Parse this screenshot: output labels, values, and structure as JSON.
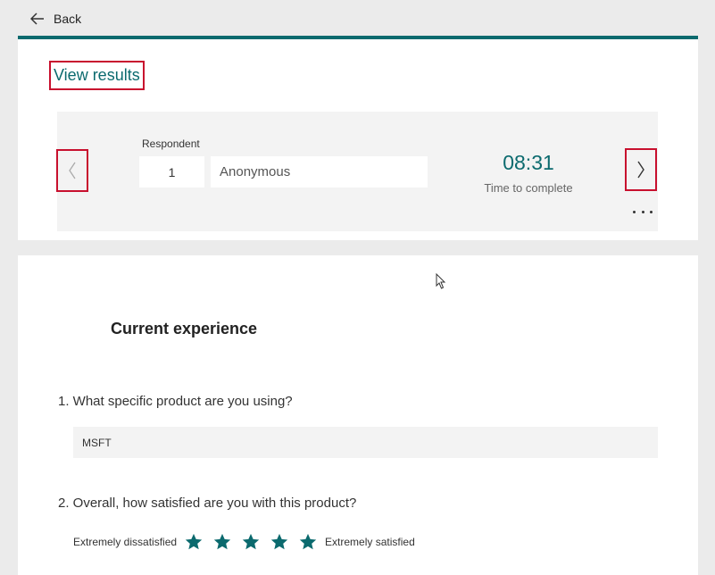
{
  "header": {
    "back_label": "Back"
  },
  "results": {
    "view_results_label": "View results"
  },
  "respondent": {
    "label": "Respondent",
    "number": "1",
    "name": "Anonymous",
    "time": "08:31",
    "time_label": "Time to complete",
    "more_icon": "more-icon"
  },
  "section": {
    "title": "Current experience"
  },
  "questions": [
    {
      "text": "1. What specific product are you using?",
      "answer": "MSFT"
    },
    {
      "text": "2. Overall, how satisfied are you with this product?",
      "min_label": "Extremely dissatisfied",
      "max_label": "Extremely satisfied",
      "rating": 5,
      "max_rating": 5
    }
  ],
  "colors": {
    "accent": "#0b6a6e",
    "highlight": "#c8102e"
  }
}
